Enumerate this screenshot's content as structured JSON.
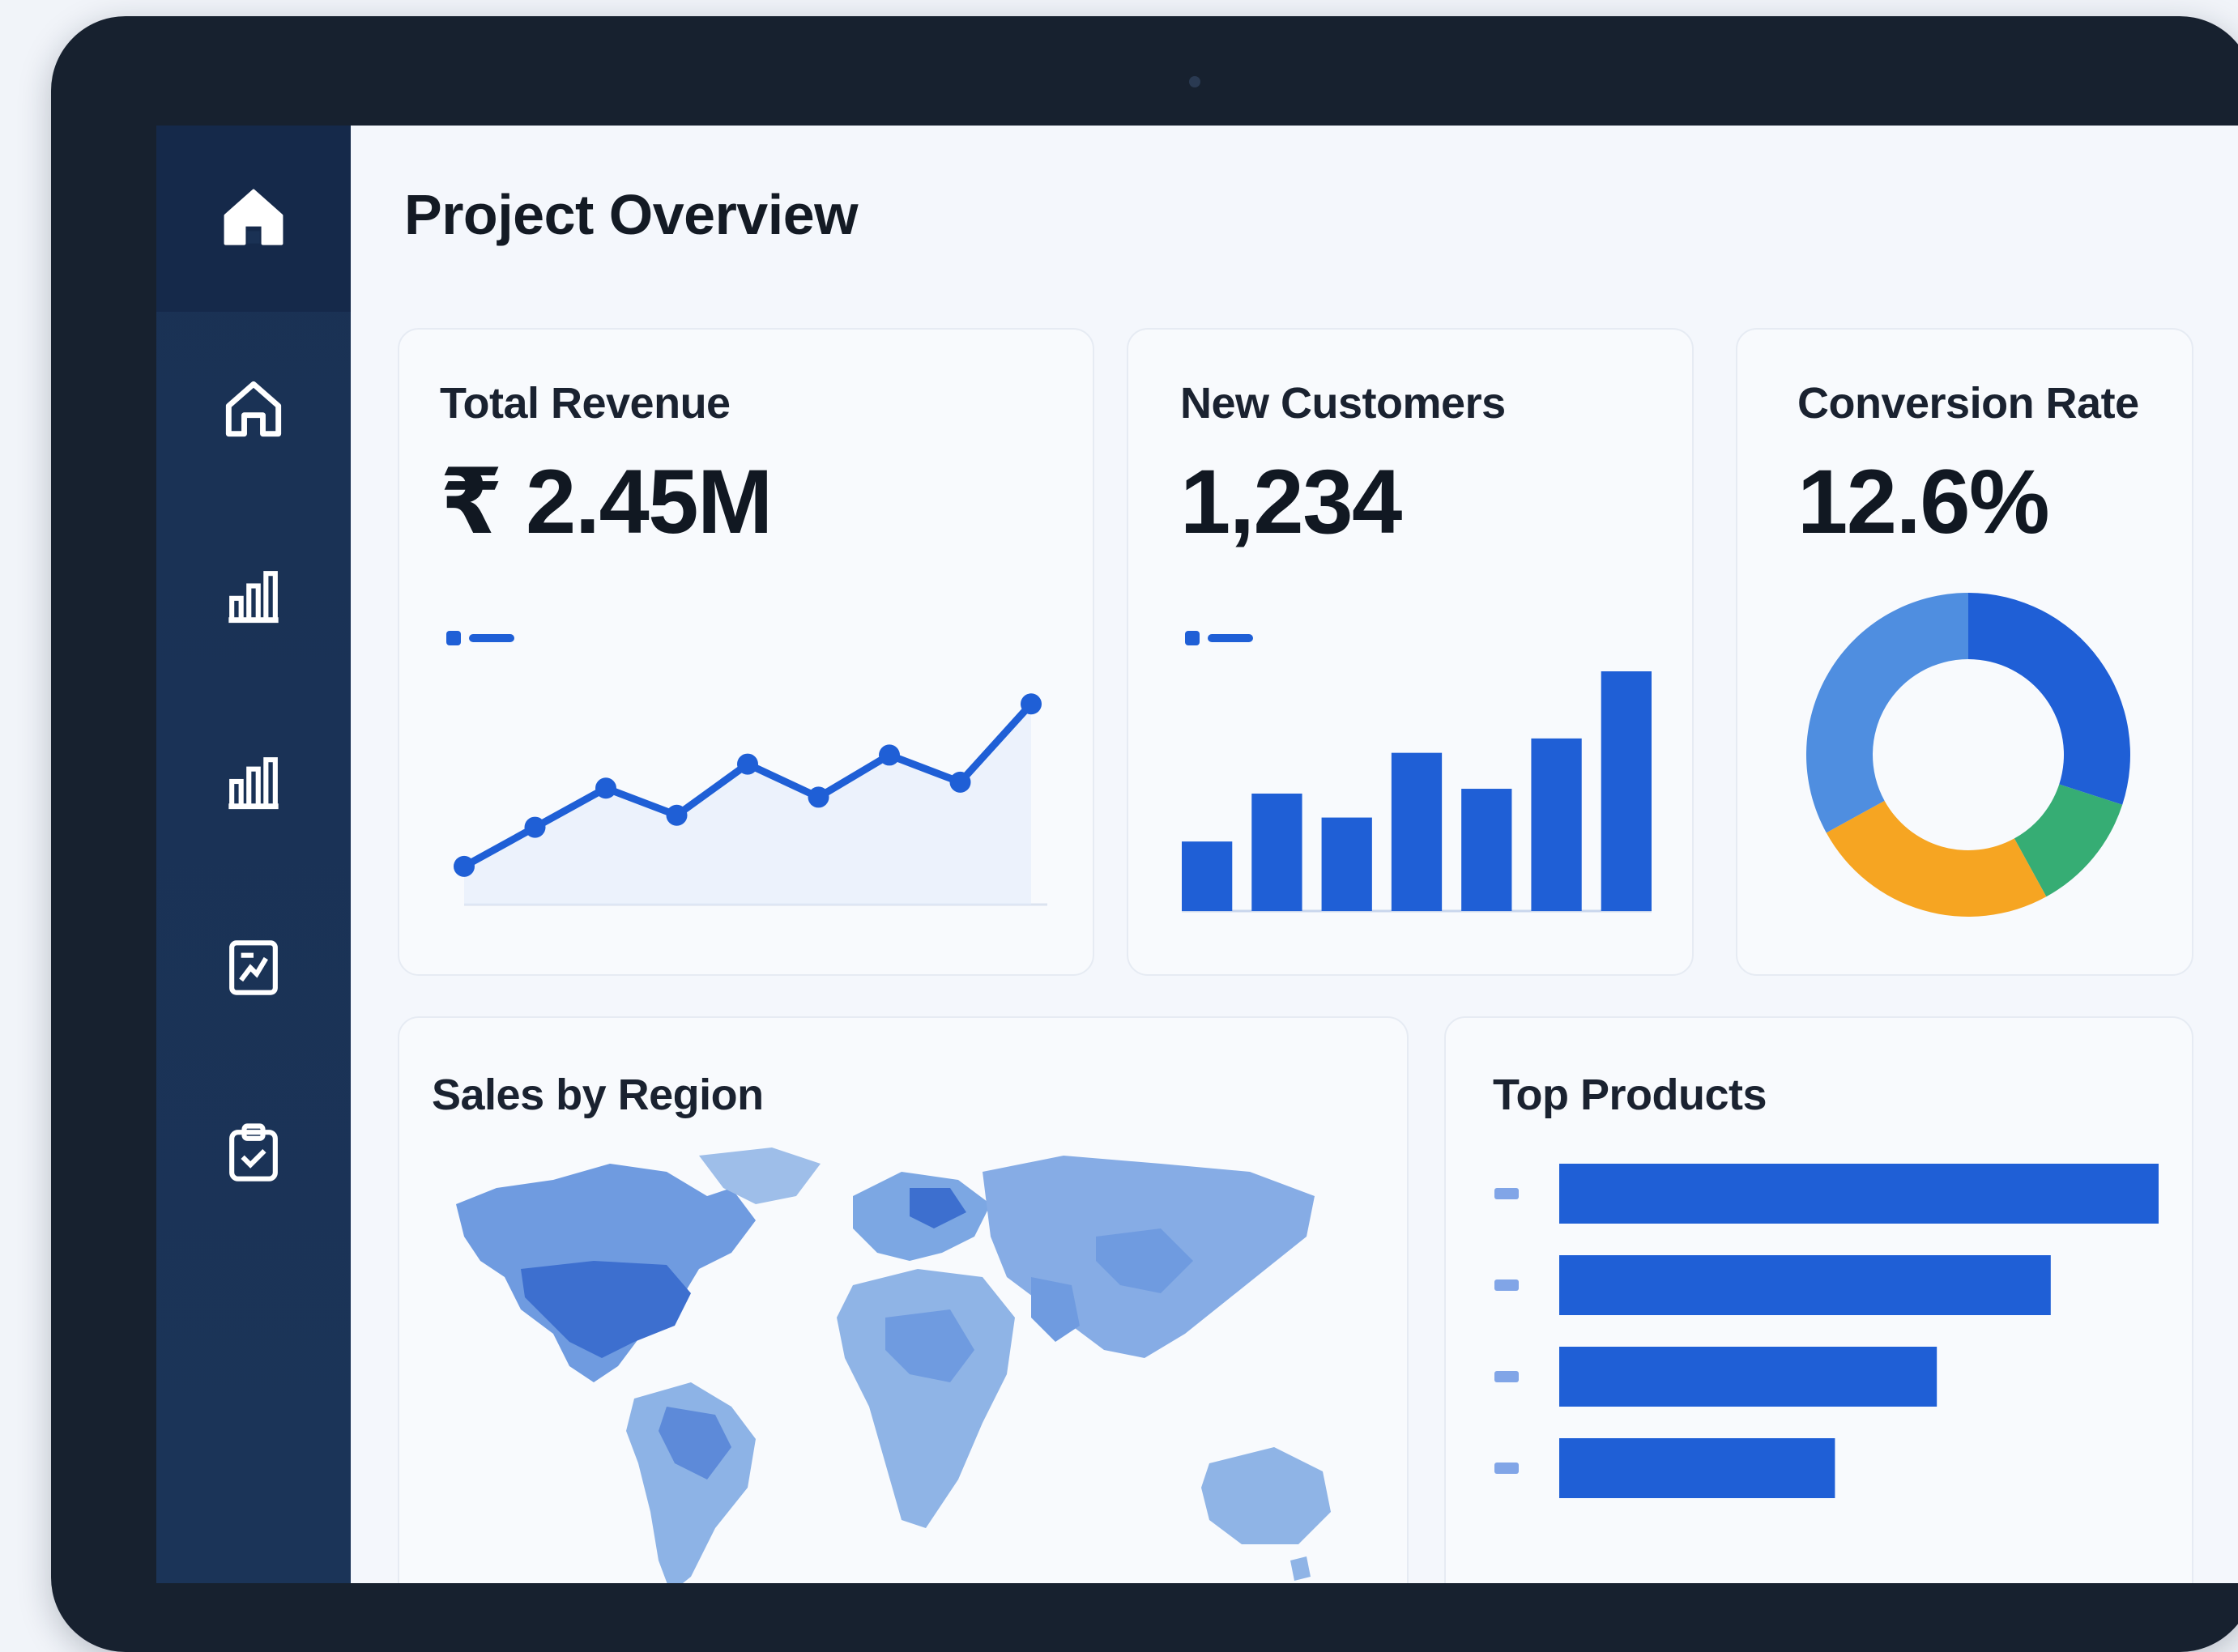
{
  "page": {
    "title": "Project Overview"
  },
  "sidebar": {
    "items": [
      {
        "icon": "home-icon",
        "active": true
      },
      {
        "icon": "home-outline-icon",
        "active": false
      },
      {
        "icon": "bar-chart-icon",
        "active": false
      },
      {
        "icon": "bar-chart-icon",
        "active": false
      },
      {
        "icon": "report-icon",
        "active": false
      },
      {
        "icon": "clipboard-icon",
        "active": false
      }
    ]
  },
  "cards": {
    "revenue": {
      "title": "Total Revenue",
      "value": "₹ 2.45M"
    },
    "customers": {
      "title": "New Customers",
      "value": "1,234"
    },
    "conversion": {
      "title": "Conversion Rate",
      "value": "12.6%"
    },
    "region": {
      "title": "Sales by Region"
    },
    "products": {
      "title": "Top Products"
    }
  },
  "colors": {
    "accent": "#1f5fd6",
    "donut_light": "#4f8ee0",
    "donut_dark": "#1f5fd6",
    "donut_green": "#36ad74",
    "donut_orange": "#f6a522",
    "map_light": "#8fb4e6",
    "map_dark": "#3d74cf"
  },
  "chart_data": [
    {
      "type": "line",
      "x": [
        1,
        2,
        3,
        4,
        5,
        6,
        7,
        8,
        9
      ],
      "series": [
        {
          "values": [
            1.0,
            2.3,
            3.6,
            2.7,
            4.4,
            3.3,
            4.7,
            3.8,
            6.4
          ]
        }
      ],
      "ylim": [
        0,
        7
      ],
      "grid": false
    },
    {
      "type": "bar",
      "categories": [
        "1",
        "2",
        "3",
        "4",
        "5",
        "6",
        "7"
      ],
      "values": [
        29,
        49,
        39,
        66,
        51,
        72,
        100
      ],
      "ylim": [
        0,
        100
      ]
    },
    {
      "type": "pie",
      "values": [
        30,
        12,
        25,
        33
      ],
      "colors": [
        "#1f5fd6",
        "#36ad74",
        "#f6a522",
        "#4f8ee0"
      ]
    },
    {
      "type": "bar",
      "orientation": "horizontal",
      "categories": [
        "",
        "",
        "",
        ""
      ],
      "values": [
        100,
        82,
        63,
        46
      ],
      "xlim": [
        0,
        100
      ]
    }
  ]
}
